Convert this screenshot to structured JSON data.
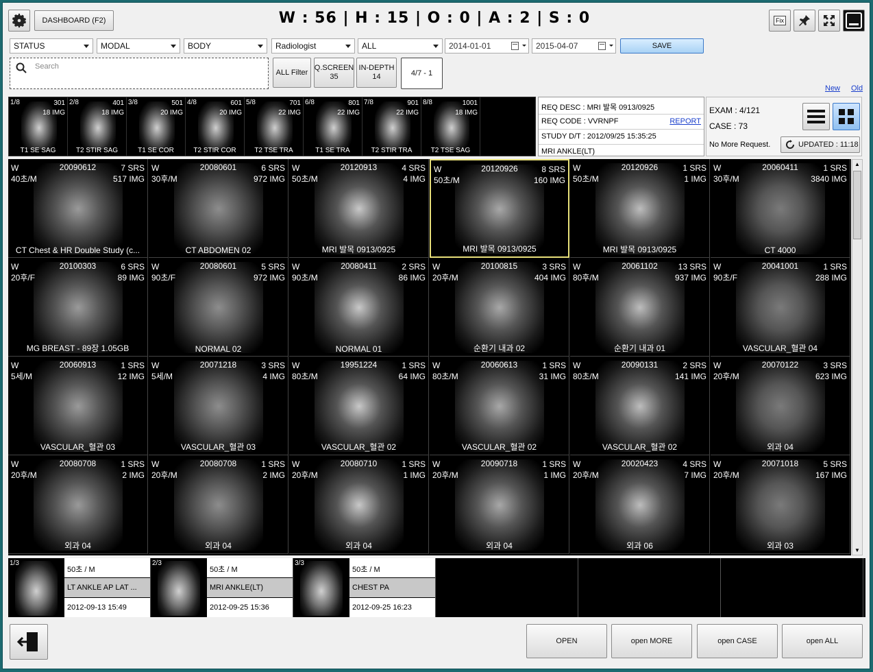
{
  "header": {
    "dashboard_label": "DASHBOARD (F2)",
    "stats_title": "W : 56 | H : 15 | O : 0 | A : 2 | S : 0",
    "fix_label": "Fix"
  },
  "filters": {
    "status": "STATUS",
    "modal": "MODAL",
    "body": "BODY",
    "role": "Radiologist",
    "scope": "ALL",
    "date_from": "2014-01-01",
    "date_to": "2015-04-07",
    "save_label": "SAVE",
    "search_placeholder": "Search",
    "all_filter_label": "ALL Filter",
    "qscreen_label": "Q.SCREEN",
    "qscreen_count": "35",
    "indepth_label": "IN-DEPTH",
    "indepth_count": "14",
    "page_label": "4/7 - 1",
    "new_link": "New",
    "old_link": "Old"
  },
  "series": [
    {
      "idx": "1/8",
      "srs": "301",
      "img": "18 IMG",
      "label": "T1 SE SAG"
    },
    {
      "idx": "2/8",
      "srs": "401",
      "img": "18 IMG",
      "label": "T2 STIR SAG"
    },
    {
      "idx": "3/8",
      "srs": "501",
      "img": "20 IMG",
      "label": "T1 SE COR"
    },
    {
      "idx": "4/8",
      "srs": "601",
      "img": "20 IMG",
      "label": "T2 STIR COR"
    },
    {
      "idx": "5/8",
      "srs": "701",
      "img": "22 IMG",
      "label": "T2 TSE TRA"
    },
    {
      "idx": "6/8",
      "srs": "801",
      "img": "22 IMG",
      "label": "T1 SE TRA"
    },
    {
      "idx": "7/8",
      "srs": "901",
      "img": "22 IMG",
      "label": "T2 STIR TRA"
    },
    {
      "idx": "8/8",
      "srs": "1001",
      "img": "18 IMG",
      "label": "T2 TSE SAG"
    }
  ],
  "request": {
    "desc": "REQ DESC : MRI 발목 0913/0925",
    "code": "REQ CODE : VVRNPF",
    "report_link": "REPORT",
    "study_dt": "STUDY D/T : 2012/09/25 15:35:25",
    "body": "MRI ANKLE(LT)"
  },
  "exam": {
    "exam_count": "EXAM : 4/121",
    "case_count": "CASE : 73",
    "no_more": "No More Request.",
    "updated": "UPDATED : 11:18"
  },
  "grid": [
    {
      "w": "W",
      "age": "40초/M",
      "date": "20090612",
      "srs": "7 SRS",
      "img": "517 IMG",
      "label": "CT Chest & HR Double Study (c..."
    },
    {
      "w": "W",
      "age": "30후/M",
      "date": "20080601",
      "srs": "6 SRS",
      "img": "972 IMG",
      "label": "CT ABDOMEN 02"
    },
    {
      "w": "W",
      "age": "50초/M",
      "date": "20120913",
      "srs": "4 SRS",
      "img": "4 IMG",
      "label": "MRI 발목 0913/0925"
    },
    {
      "w": "W",
      "age": "50초/M",
      "date": "20120926",
      "srs": "8 SRS",
      "img": "160 IMG",
      "label": "MRI 발목 0913/0925"
    },
    {
      "w": "W",
      "age": "50초/M",
      "date": "20120926",
      "srs": "1 SRS",
      "img": "1 IMG",
      "label": "MRI 발목 0913/0925"
    },
    {
      "w": "W",
      "age": "30후/M",
      "date": "20060411",
      "srs": "1 SRS",
      "img": "3840 IMG",
      "label": "CT 4000"
    },
    {
      "w": "W",
      "age": "20후/F",
      "date": "20100303",
      "srs": "6 SRS",
      "img": "89 IMG",
      "label": "MG BREAST - 89장 1.05GB"
    },
    {
      "w": "W",
      "age": "90초/F",
      "date": "20080601",
      "srs": "5 SRS",
      "img": "972 IMG",
      "label": "NORMAL 02"
    },
    {
      "w": "W",
      "age": "90초/M",
      "date": "20080411",
      "srs": "2 SRS",
      "img": "86 IMG",
      "label": "NORMAL 01"
    },
    {
      "w": "W",
      "age": "20후/M",
      "date": "20100815",
      "srs": "3 SRS",
      "img": "404 IMG",
      "label": "순환기 내과 02"
    },
    {
      "w": "W",
      "age": "80후/M",
      "date": "20061102",
      "srs": "13 SRS",
      "img": "937 IMG",
      "label": "순환기 내과 01"
    },
    {
      "w": "W",
      "age": "90초/F",
      "date": "20041001",
      "srs": "1 SRS",
      "img": "288 IMG",
      "label": "VASCULAR_혈관 04"
    },
    {
      "w": "W",
      "age": "5세/M",
      "date": "20060913",
      "srs": "1 SRS",
      "img": "12 IMG",
      "label": "VASCULAR_혈관 03"
    },
    {
      "w": "W",
      "age": "5세/M",
      "date": "20071218",
      "srs": "3 SRS",
      "img": "4 IMG",
      "label": "VASCULAR_혈관 03"
    },
    {
      "w": "W",
      "age": "80초/M",
      "date": "19951224",
      "srs": "1 SRS",
      "img": "64 IMG",
      "label": "VASCULAR_혈관 02"
    },
    {
      "w": "W",
      "age": "80초/M",
      "date": "20060613",
      "srs": "1 SRS",
      "img": "31 IMG",
      "label": "VASCULAR_혈관 02"
    },
    {
      "w": "W",
      "age": "80초/M",
      "date": "20090131",
      "srs": "2 SRS",
      "img": "141 IMG",
      "label": "VASCULAR_혈관 02"
    },
    {
      "w": "W",
      "age": "20후/M",
      "date": "20070122",
      "srs": "3 SRS",
      "img": "623 IMG",
      "label": "외과 04"
    },
    {
      "w": "W",
      "age": "20후/M",
      "date": "20080708",
      "srs": "1 SRS",
      "img": "2 IMG",
      "label": "외과 04"
    },
    {
      "w": "W",
      "age": "20후/M",
      "date": "20080708",
      "srs": "1 SRS",
      "img": "2 IMG",
      "label": "외과 04"
    },
    {
      "w": "W",
      "age": "20후/M",
      "date": "20080710",
      "srs": "1 SRS",
      "img": "1 IMG",
      "label": "외과 04"
    },
    {
      "w": "W",
      "age": "20후/M",
      "date": "20090718",
      "srs": "1 SRS",
      "img": "1 IMG",
      "label": "외과 04"
    },
    {
      "w": "W",
      "age": "20후/M",
      "date": "20020423",
      "srs": "4 SRS",
      "img": "7 IMG",
      "label": "외과 06"
    },
    {
      "w": "W",
      "age": "20후/M",
      "date": "20071018",
      "srs": "5 SRS",
      "img": "167 IMG",
      "label": "외과 03"
    }
  ],
  "bottom": [
    {
      "idx": "1/3",
      "age": "50초 / M",
      "desc": "LT ANKLE  AP LAT ...",
      "dt": "2012-09-13 15:49"
    },
    {
      "idx": "2/3",
      "age": "50초 / M",
      "desc": "MRI ANKLE(LT)",
      "dt": "2012-09-25 15:36"
    },
    {
      "idx": "3/3",
      "age": "50초 / M",
      "desc": "CHEST PA",
      "dt": "2012-09-25 16:23"
    }
  ],
  "actions": {
    "open": "OPEN",
    "open_more": "open MORE",
    "open_case": "open CASE",
    "open_all": "open ALL"
  },
  "colors": {
    "selected_border": "#e8e07a",
    "accent_blue": "#3a78c8",
    "frame": "#1d6a70"
  }
}
